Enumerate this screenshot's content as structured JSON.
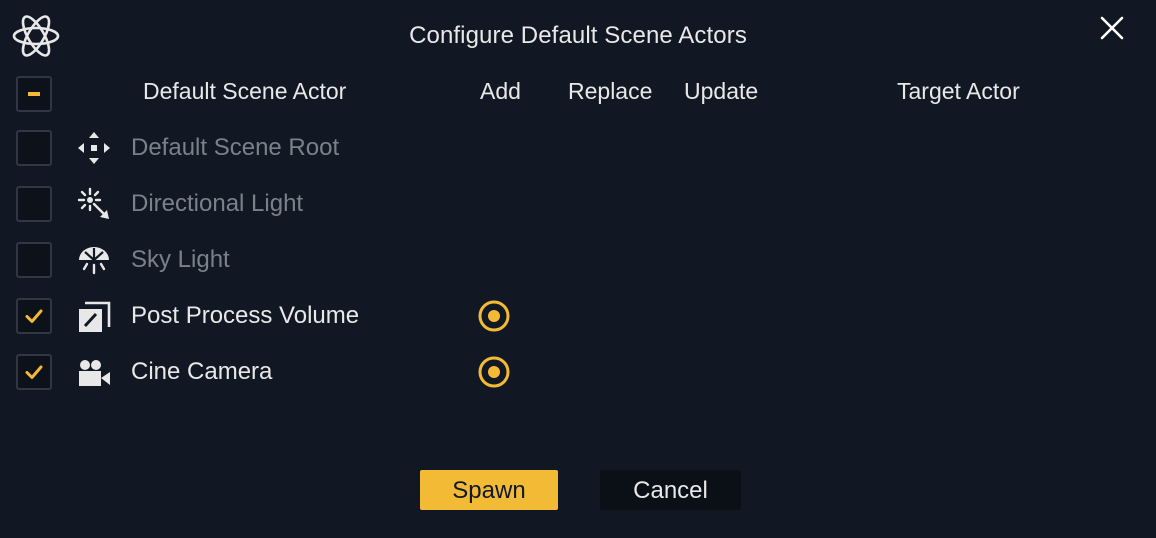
{
  "dialog": {
    "title": "Configure Default Scene Actors",
    "logo_icon": "atom-logo-icon",
    "close_icon": "close-icon"
  },
  "columns": {
    "actor": "Default Scene Actor",
    "add": "Add",
    "replace": "Replace",
    "update": "Update",
    "target": "Target Actor"
  },
  "select_all": {
    "state": "indeterminate"
  },
  "rows": [
    {
      "label": "Default Scene Root",
      "icon": "move-arrows-icon",
      "checked": false,
      "add_selected": false
    },
    {
      "label": "Directional Light",
      "icon": "directional-light-icon",
      "checked": false,
      "add_selected": false
    },
    {
      "label": "Sky Light",
      "icon": "sky-light-icon",
      "checked": false,
      "add_selected": false
    },
    {
      "label": "Post Process Volume",
      "icon": "post-process-volume-icon",
      "checked": true,
      "add_selected": true
    },
    {
      "label": "Cine Camera",
      "icon": "cine-camera-icon",
      "checked": true,
      "add_selected": true
    }
  ],
  "buttons": {
    "spawn": "Spawn",
    "cancel": "Cancel"
  },
  "colors": {
    "background": "#121823",
    "accent": "#f3bb35",
    "text": "#e8e8e8",
    "text_dim": "#7b818a",
    "checkbox_bg": "#0c111a",
    "checkbox_border": "#2f3744"
  }
}
